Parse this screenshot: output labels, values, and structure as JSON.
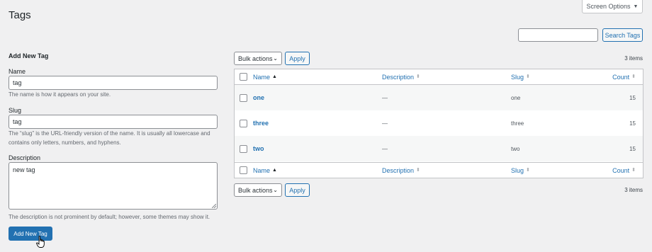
{
  "header": {
    "title": "Tags",
    "screen_options": "Screen Options",
    "search_placeholder": "",
    "search_button": "Search Tags"
  },
  "form": {
    "title": "Add New Tag",
    "name_label": "Name",
    "name_value": "tag",
    "name_help": "The name is how it appears on your site.",
    "slug_label": "Slug",
    "slug_value": "tag",
    "slug_help_line1": "The “slug” is the URL-friendly version of the name. It is usually all lowercase and",
    "slug_help_line2": "contains only letters, numbers, and hyphens.",
    "description_label": "Description",
    "description_value": "new tag",
    "description_help": "The description is not prominent by default; however, some themes may show it.",
    "submit_label": "Add New Tag"
  },
  "table_nav": {
    "bulk_actions": "Bulk actions",
    "apply": "Apply",
    "items_count": "3 items"
  },
  "table": {
    "columns": {
      "name": "Name",
      "description": "Description",
      "slug": "Slug",
      "count": "Count"
    },
    "rows": [
      {
        "name": "one",
        "description": "—",
        "slug": "one",
        "count": "15"
      },
      {
        "name": "three",
        "description": "—",
        "slug": "three",
        "count": "15"
      },
      {
        "name": "two",
        "description": "—",
        "slug": "two",
        "count": "15"
      }
    ]
  },
  "colors": {
    "accent": "#2271b1",
    "background": "#f0f0f1",
    "border": "#c3c4c7"
  }
}
